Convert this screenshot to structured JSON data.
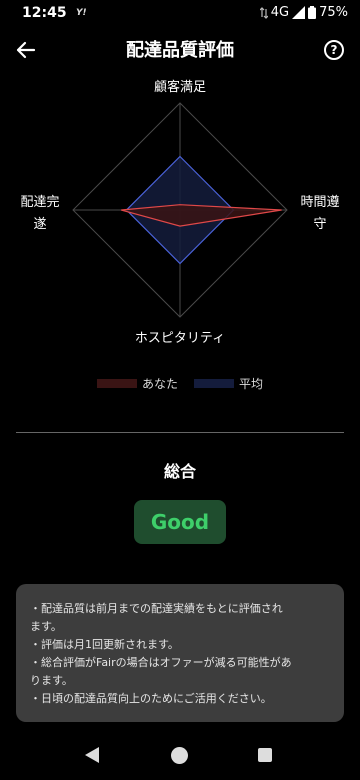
{
  "status_bar": {
    "time": "12:45",
    "app_icon": "Y!",
    "network": "4G",
    "battery": "75%"
  },
  "header": {
    "title": "配達品質評価",
    "back_icon": "arrow-left-icon",
    "help_label": "?"
  },
  "chart_data": {
    "type": "radar",
    "axes": [
      "顧客満足",
      "時間遵守",
      "ホスピタリティ",
      "配達完遂"
    ],
    "axis_label_lines": {
      "top": [
        "顧客満足"
      ],
      "right": [
        "時間遵",
        "守"
      ],
      "bottom": [
        "ホスピタリティ"
      ],
      "left": [
        "配達完",
        "遂"
      ]
    },
    "range": [
      0,
      100
    ],
    "series": [
      {
        "name": "あなた",
        "values": [
          5,
          95,
          15,
          55
        ],
        "color": "#e04848",
        "fill": "#3a1414"
      },
      {
        "name": "平均",
        "values": [
          50,
          50,
          50,
          50
        ],
        "color": "#4a62d8",
        "fill": "#141c3c"
      }
    ],
    "grid_levels": [
      100
    ]
  },
  "overall": {
    "title": "総合",
    "rating": "Good",
    "rating_color": "#3ecf6a"
  },
  "info": {
    "lines": [
      "・配達品質は前月までの配達実績をもとに評価され",
      "ます。",
      "・評価は月1回更新されます。",
      "・総合評価がFairの場合はオファーが減る可能性があ",
      "ります。",
      "・日頃の配達品質向上のためにご活用ください。"
    ]
  },
  "nav_bar": {
    "back_icon": "triangle-back-icon",
    "home_icon": "circle-home-icon",
    "recents_icon": "square-recents-icon"
  }
}
